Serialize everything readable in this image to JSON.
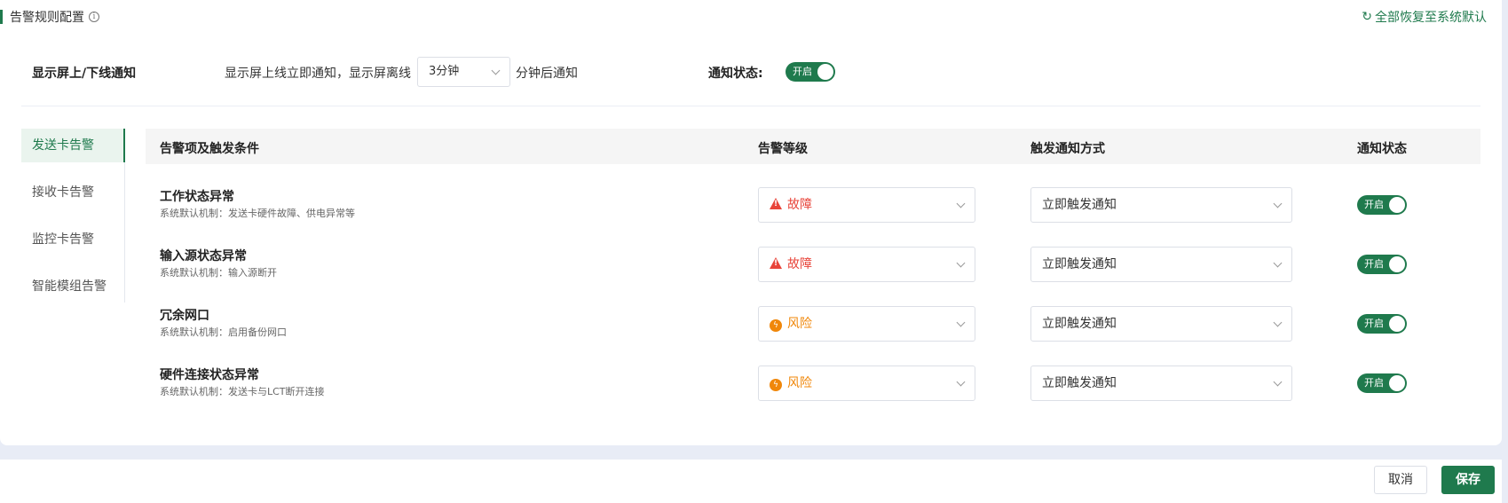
{
  "header": {
    "title": "告警规则配置",
    "info_icon": "i",
    "reset_label": "全部恢复至系统默认",
    "reset_icon": "↻"
  },
  "screen_notify": {
    "label": "显示屏上/下线通知",
    "desc": "显示屏上线立即通知，显示屏离线",
    "delay_value": "3分钟",
    "after": "分钟后通知",
    "status_label": "通知状态:",
    "toggle_text": "开启"
  },
  "sidebar": {
    "items": [
      {
        "label": "发送卡告警"
      },
      {
        "label": "接收卡告警"
      },
      {
        "label": "监控卡告警"
      },
      {
        "label": "智能模组告警"
      }
    ]
  },
  "table": {
    "headers": [
      "告警项及触发条件",
      "告警等级",
      "触发通知方式",
      "通知状态"
    ],
    "rows": [
      {
        "title": "工作状态异常",
        "desc": "系统默认机制：发送卡硬件故障、供电异常等",
        "level": "故障",
        "method": "立即触发通知",
        "status": "开启"
      },
      {
        "title": "输入源状态异常",
        "desc": "系统默认机制：输入源断开",
        "level": "故障",
        "method": "立即触发通知",
        "status": "开启"
      },
      {
        "title": "冗余网口",
        "desc": "系统默认机制：启用备份网口",
        "level": "风险",
        "method": "立即触发通知",
        "status": "开启"
      },
      {
        "title": "硬件连接状态异常",
        "desc": "系统默认机制：发送卡与LCT断开连接",
        "level": "风险",
        "method": "立即触发通知",
        "status": "开启"
      }
    ]
  },
  "footer": {
    "cancel_label": "取消",
    "save_label": "保存"
  },
  "colors": {
    "accent": "#1f7a4d",
    "fault": "#e8443a",
    "risk": "#f0870a"
  }
}
